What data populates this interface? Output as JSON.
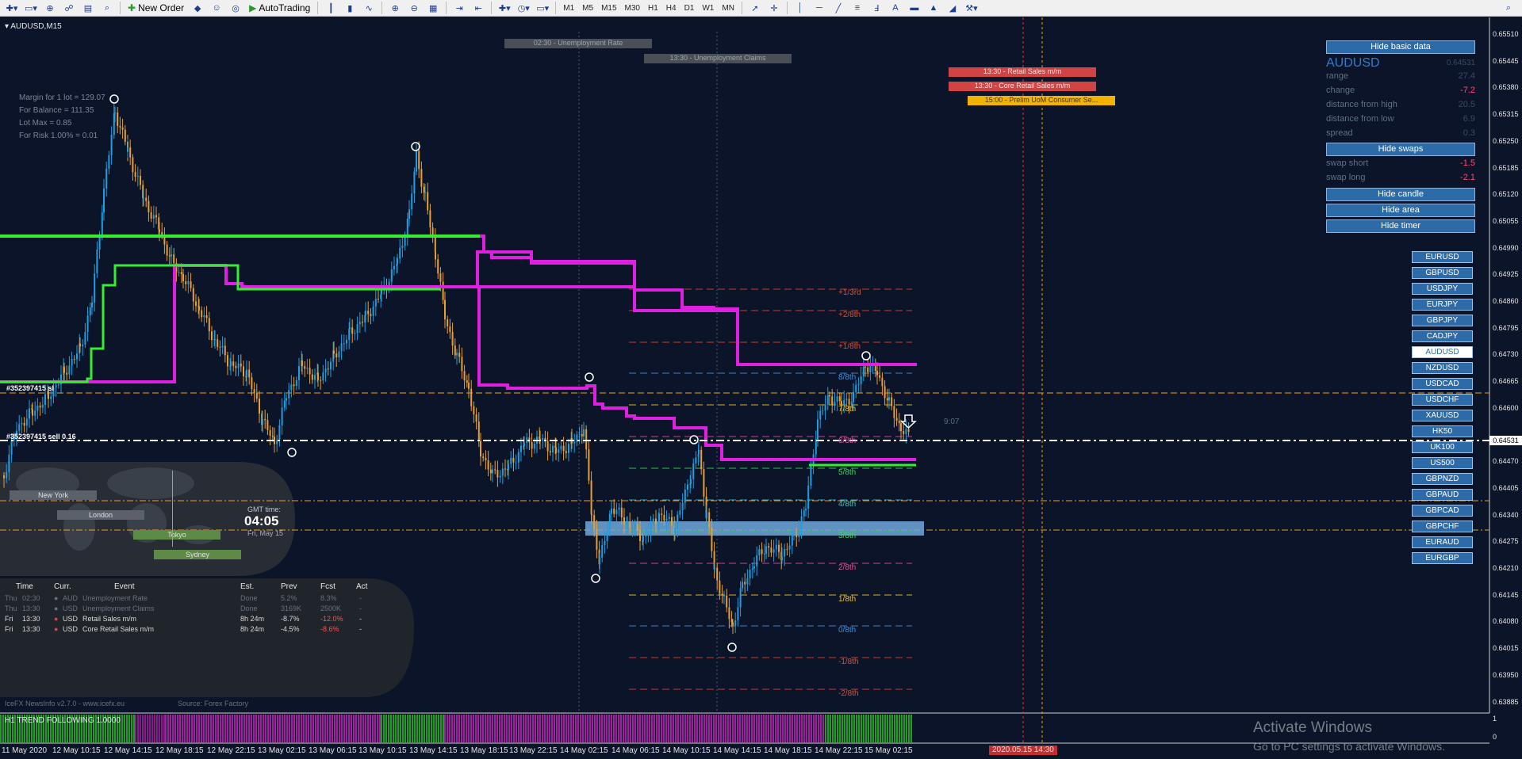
{
  "toolbar": {
    "new_order_label": "New Order",
    "autotrading_label": "AutoTrading",
    "timeframes": [
      "M1",
      "M5",
      "M15",
      "M30",
      "H1",
      "H4",
      "D1",
      "W1",
      "MN"
    ]
  },
  "chart": {
    "symbol_label": "AUDUSD,M15",
    "current_price": "0.64531",
    "price_ticks": [
      "0.65510",
      "0.65445",
      "0.65380",
      "0.65315",
      "0.65250",
      "0.65185",
      "0.65120",
      "0.65055",
      "0.64990",
      "0.64925",
      "0.64860",
      "0.64795",
      "0.64730",
      "0.64665",
      "0.64600",
      "0.64531",
      "0.64470",
      "0.64405",
      "0.64340",
      "0.64275",
      "0.64210",
      "0.64145",
      "0.64080",
      "0.64015",
      "0.63950",
      "0.63885"
    ],
    "time_ticks": [
      "11 May 2020",
      "12 May 10:15",
      "12 May 14:15",
      "12 May 18:15",
      "12 May 22:15",
      "13 May 02:15",
      "13 May 06:15",
      "13 May 10:15",
      "13 May 14:15",
      "13 May 18:15",
      "13 May 22:15",
      "14 May 02:15",
      "14 May 06:15",
      "14 May 10:15",
      "14 May 14:15",
      "14 May 18:15",
      "14 May 22:15",
      "15 May 02:15"
    ],
    "cursor_time": "2020.05.15 14:30",
    "countdown": "9:07",
    "order_label_1": "#352397415 sl",
    "order_label_2": "#352397415 sell 0.16"
  },
  "news_tags": {
    "t1": "02:30 - Unemployment Rate",
    "t2": "13:30 - Unemployment Claims",
    "t3": "13:30 - Retail Sales m/m",
    "t4": "13:30 - Core Retail Sales m/m",
    "t5": "15:00 - Prelim UoM Consumer Se..."
  },
  "murrey_levels": {
    "l1": "+1/3rd",
    "l2": "+2/8th",
    "l3": "+1/8th",
    "l4": "8/8th",
    "l5": "7/8th",
    "l6": "6/8th",
    "l7": "5/8th",
    "l8": "4/8th",
    "l9": "3/8th",
    "l10": "2/8th",
    "l11": "1/8th",
    "l12": "0/8th",
    "l13": "-1/8th",
    "l14": "-2/8th"
  },
  "margin_info": {
    "line1": "Margin for 1 lot = 129.07",
    "line2": "For Balance = 111.35",
    "line3": "Lot Max = 0.85",
    "line4": "For Risk 1.00% = 0.01"
  },
  "sessions": {
    "new_york": "New York",
    "london": "London",
    "tokyo": "Tokyo",
    "sydney": "Sydney",
    "gmt_label": "GMT time:",
    "gmt_time": "04:05",
    "gmt_date": "Fri, May 15"
  },
  "news_table": {
    "headers": {
      "time": "Time",
      "curr": "Curr.",
      "event": "Event",
      "est": "Est.",
      "prev": "Prev",
      "fcst": "Fcst",
      "act": "Act"
    },
    "rows": [
      {
        "day": "Thu",
        "time": "02:30",
        "curr": "AUD",
        "event": "Unemployment Rate",
        "est": "Done",
        "prev": "5.2%",
        "fcst": "8.3%",
        "act": "-"
      },
      {
        "day": "Thu",
        "time": "13:30",
        "curr": "USD",
        "event": "Unemployment Claims",
        "est": "Done",
        "prev": "3169K",
        "fcst": "2500K",
        "act": "-"
      },
      {
        "day": "Fri",
        "time": "13:30",
        "curr": "USD",
        "event": "Retail Sales m/m",
        "est": "8h 24m",
        "prev": "-8.7%",
        "fcst": "-12.0%",
        "act": "-"
      },
      {
        "day": "Fri",
        "time": "13:30",
        "curr": "USD",
        "event": "Core Retail Sales m/m",
        "est": "8h 24m",
        "prev": "-4.5%",
        "fcst": "-8.6%",
        "act": "-"
      }
    ],
    "footer_version": "IceFX NewsInfo v2.7.0  -  www.icefx.eu",
    "footer_source": "Source: Forex Factory"
  },
  "basic_data": {
    "hide_basic_label": "Hide basic data",
    "symbol": "AUDUSD",
    "price": "0.64531",
    "range_label": "range",
    "range_value": "27.4",
    "change_label": "change",
    "change_value": "-7.2",
    "dist_high_label": "distance from high",
    "dist_high_value": "20.5",
    "dist_low_label": "distance from low",
    "dist_low_value": "6.9",
    "spread_label": "spread",
    "spread_value": "0.3",
    "hide_swaps_label": "Hide swaps",
    "swap_short_label": "swap short",
    "swap_short_value": "-1.5",
    "swap_long_label": "swap long",
    "swap_long_value": "-2.1",
    "hide_candle_label": "Hide candle",
    "hide_area_label": "Hide area",
    "hide_timer_label": "Hide timer"
  },
  "symbols": [
    "EURUSD",
    "GBPUSD",
    "USDJPY",
    "EURJPY",
    "GBPJPY",
    "CADJPY",
    "AUDUSD",
    "NZDUSD",
    "USDCAD",
    "USDCHF",
    "XAUUSD",
    "HK50",
    "UK100",
    "US500",
    "GBPNZD",
    "GBPAUD",
    "GBPCAD",
    "GBPCHF",
    "EURAUD",
    "EURGBP"
  ],
  "indicator": {
    "label": "H1 TREND FOLLOWING 1.0000",
    "scale_top": "1",
    "scale_bottom": "0"
  },
  "watermark": {
    "line1": "Activate Windows",
    "line2": "Go to PC settings to activate Windows."
  },
  "colors": {
    "background": "#0b1428",
    "bull": "#1f9fe0",
    "bear": "#e8a030",
    "magenta": "#e020e0",
    "green": "#33ee33"
  }
}
